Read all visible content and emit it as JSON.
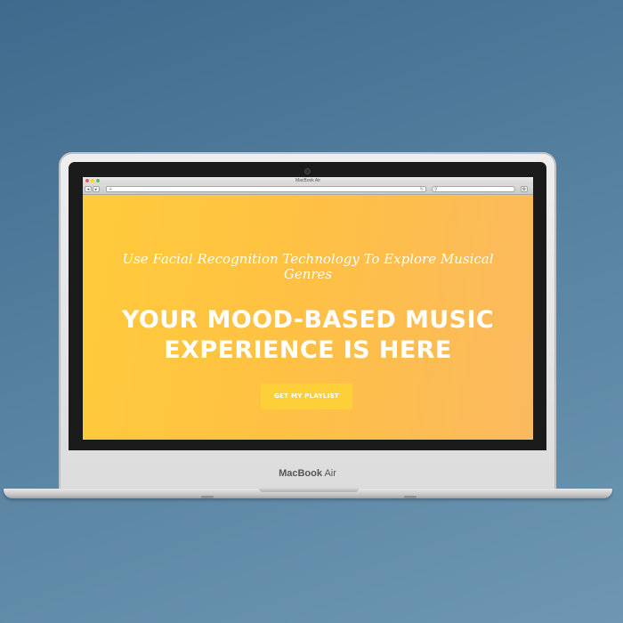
{
  "device": {
    "brand_name": "MacBook",
    "brand_model": "Air"
  },
  "browser": {
    "window_title": "MacBook Air",
    "back_icon": "back-arrow-icon",
    "forward_icon": "forward-arrow-icon",
    "url_plus": "+",
    "reload_icon": "↻",
    "search_icon": "magnifier",
    "gear_icon": "⚙",
    "traffic_lights": [
      "#ed594a",
      "#fdd800",
      "#5ac05a"
    ]
  },
  "hero": {
    "subtitle": "Use Facial Recognition Technology To Explore Musical Genres",
    "headline_line1": "YOUR MOOD-BASED MUSIC",
    "headline_line2": "EXPERIENCE IS HERE",
    "cta_label": "GET MY PLAYLIST",
    "gradient_start": "#ffcb3b",
    "gradient_end": "#fbb95f",
    "cta_color": "#fdd03a"
  }
}
